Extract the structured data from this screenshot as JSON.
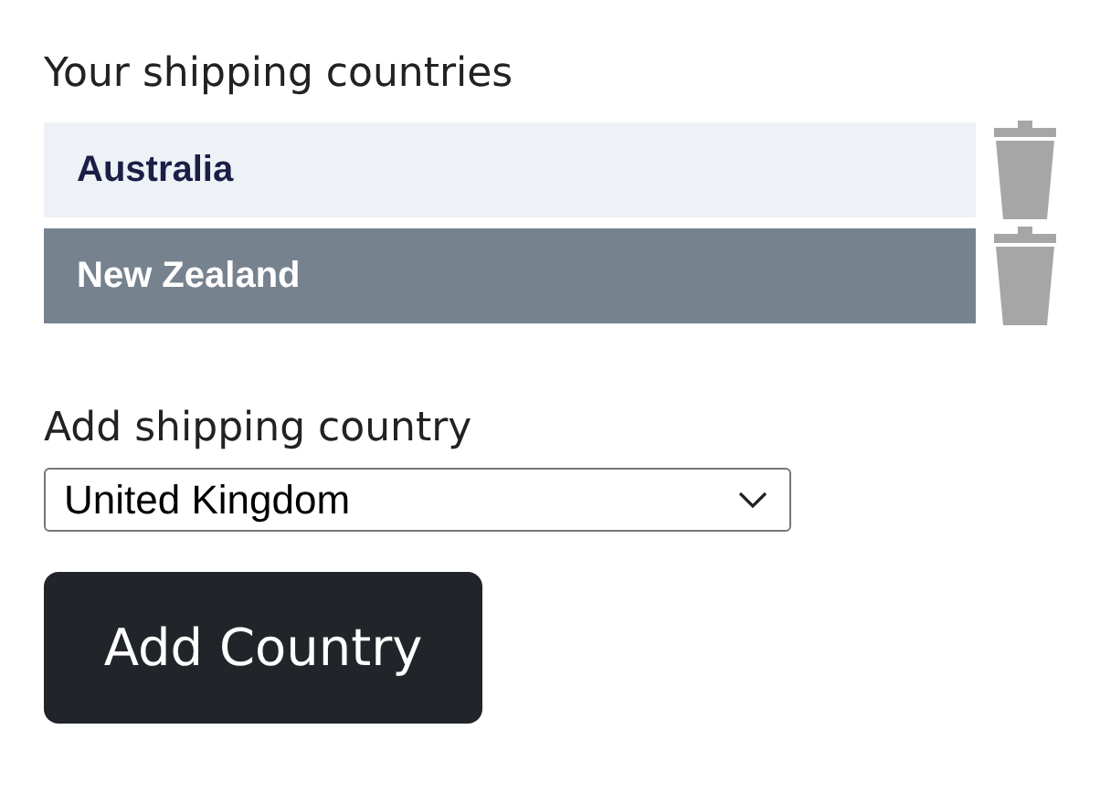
{
  "heading": "Your shipping countries",
  "countries": [
    {
      "name": "Australia",
      "selected": false
    },
    {
      "name": "New Zealand",
      "selected": true
    }
  ],
  "add_label": "Add shipping country",
  "country_select": {
    "value": "United Kingdom"
  },
  "add_button": "Add Country"
}
